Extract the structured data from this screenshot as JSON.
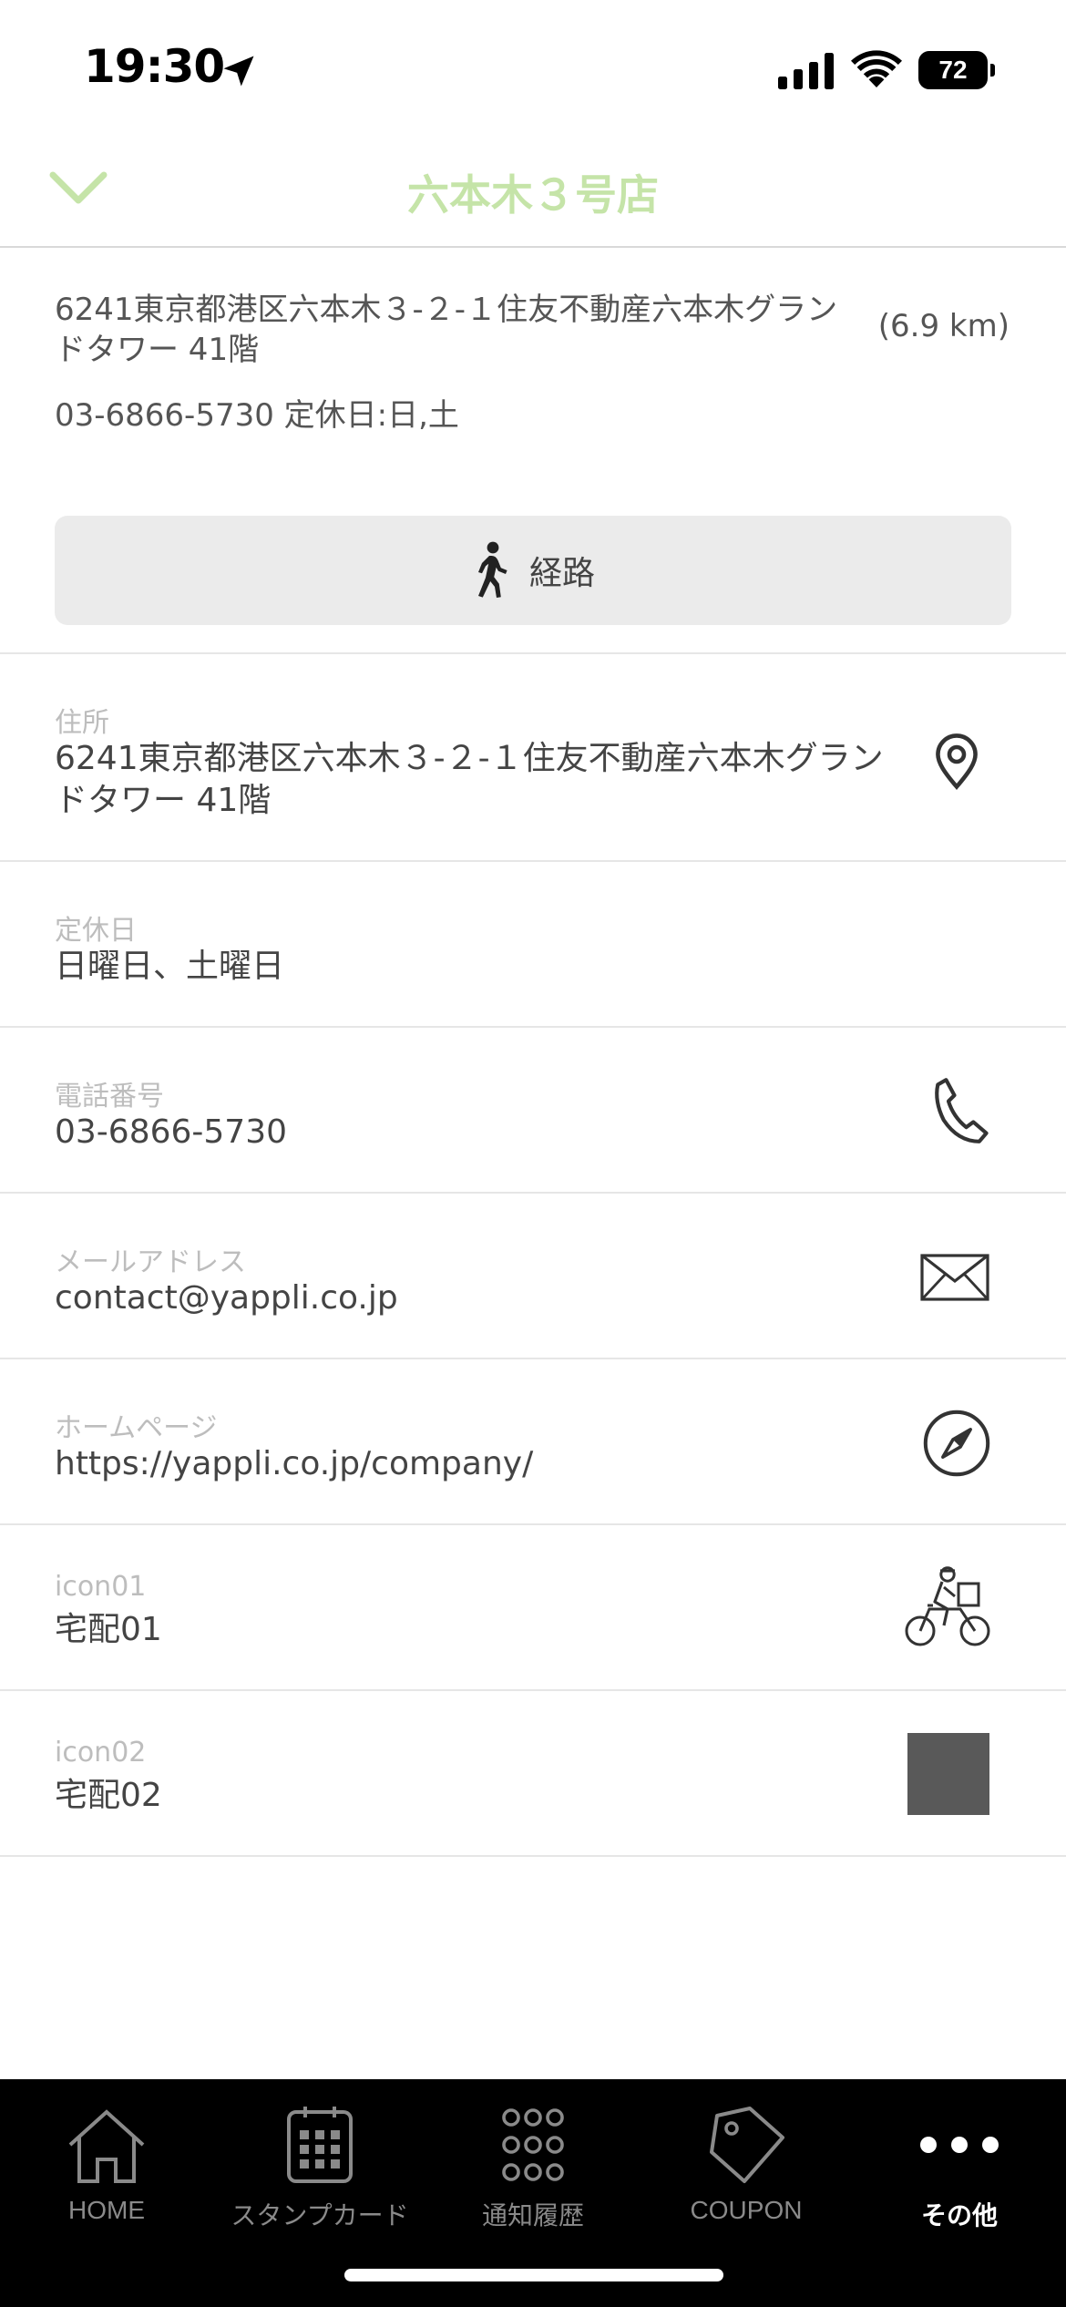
{
  "status": {
    "time": "19:30",
    "battery": "72",
    "icons": [
      "location-arrow-icon",
      "signal-icon",
      "wifi-icon",
      "battery-icon"
    ]
  },
  "nav": {
    "title": "六本木３号店",
    "back_icon": "chevron-down-icon",
    "title_color": "#c5e4a8"
  },
  "summary": {
    "address": "6241東京都港区六本木３-２-１住友不動産六本木グランドタワー 41階",
    "distance": "(6.9 km)",
    "phone_holiday": "03-6866-5730 定休日:日,土",
    "route_label": "経路",
    "route_icon": "walking-person-icon"
  },
  "rows": [
    {
      "label": "住所",
      "value": "6241東京都港区六本木３-２-１住友不動産六本木グランドタワー 41階",
      "icon": "map-pin-icon"
    },
    {
      "label": "定休日",
      "value": "日曜日、土曜日",
      "icon": ""
    },
    {
      "label": "電話番号",
      "value": "03-6866-5730",
      "icon": "phone-icon"
    },
    {
      "label": "メールアドレス",
      "value": " contact@yappli.co.jp",
      "icon": "mail-icon"
    },
    {
      "label": "ホームページ",
      "value": "https://yappli.co.jp/company/",
      "icon": "compass-icon"
    },
    {
      "label": "icon01",
      "value": "宅配01",
      "icon": "delivery-bike-icon"
    },
    {
      "label": "icon02",
      "value": "宅配02",
      "icon": "gray-square-image"
    }
  ],
  "tabs": [
    {
      "label": "HOME",
      "icon": "home-icon",
      "active": false
    },
    {
      "label": "スタンプカード",
      "icon": "calendar-icon",
      "active": false
    },
    {
      "label": "通知履歴",
      "icon": "grid-dots-icon",
      "active": false
    },
    {
      "label": "COUPON",
      "icon": "tag-icon",
      "active": false
    },
    {
      "label": "その他",
      "icon": "more-dots-icon",
      "active": true
    }
  ]
}
